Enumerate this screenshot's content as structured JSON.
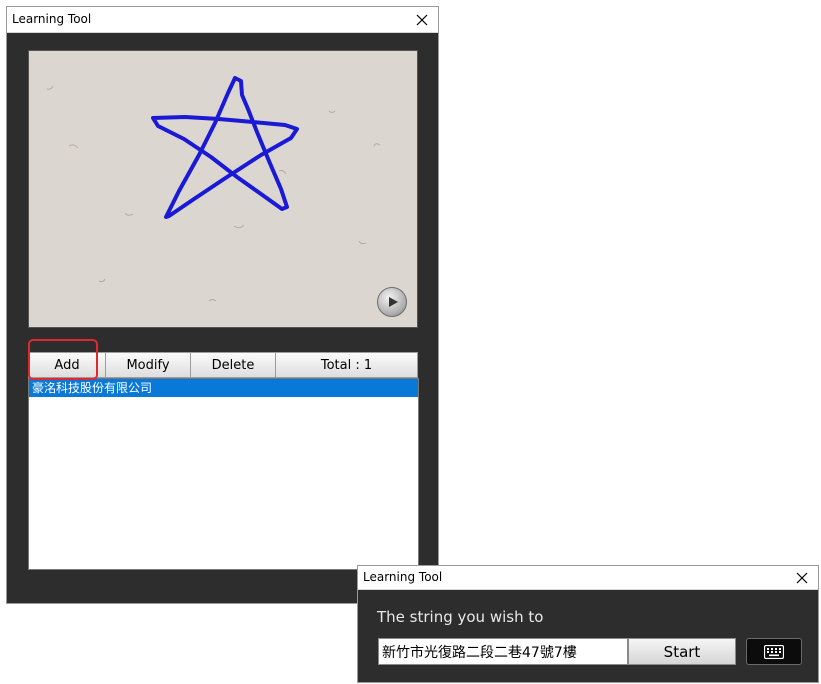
{
  "main_window": {
    "title": "Learning Tool",
    "toolbar": {
      "add_label": "Add",
      "modify_label": "Modify",
      "delete_label": "Delete",
      "total_label": "Total : 1"
    },
    "list_items": [
      {
        "label": "豪洺科技股份有限公司"
      }
    ]
  },
  "input_window": {
    "title": "Learning Tool",
    "prompt": "The string you wish to",
    "input_value": "新竹市光復路二段二巷47號7樓",
    "start_label": "Start"
  },
  "icons": {
    "close": "close-icon",
    "play": "play-icon",
    "keyboard": "keyboard-icon"
  },
  "colors": {
    "window_bg": "#2d2d2d",
    "selection": "#0a78d7",
    "highlight": "#e0282e",
    "stroke": "#1a1ad6"
  }
}
